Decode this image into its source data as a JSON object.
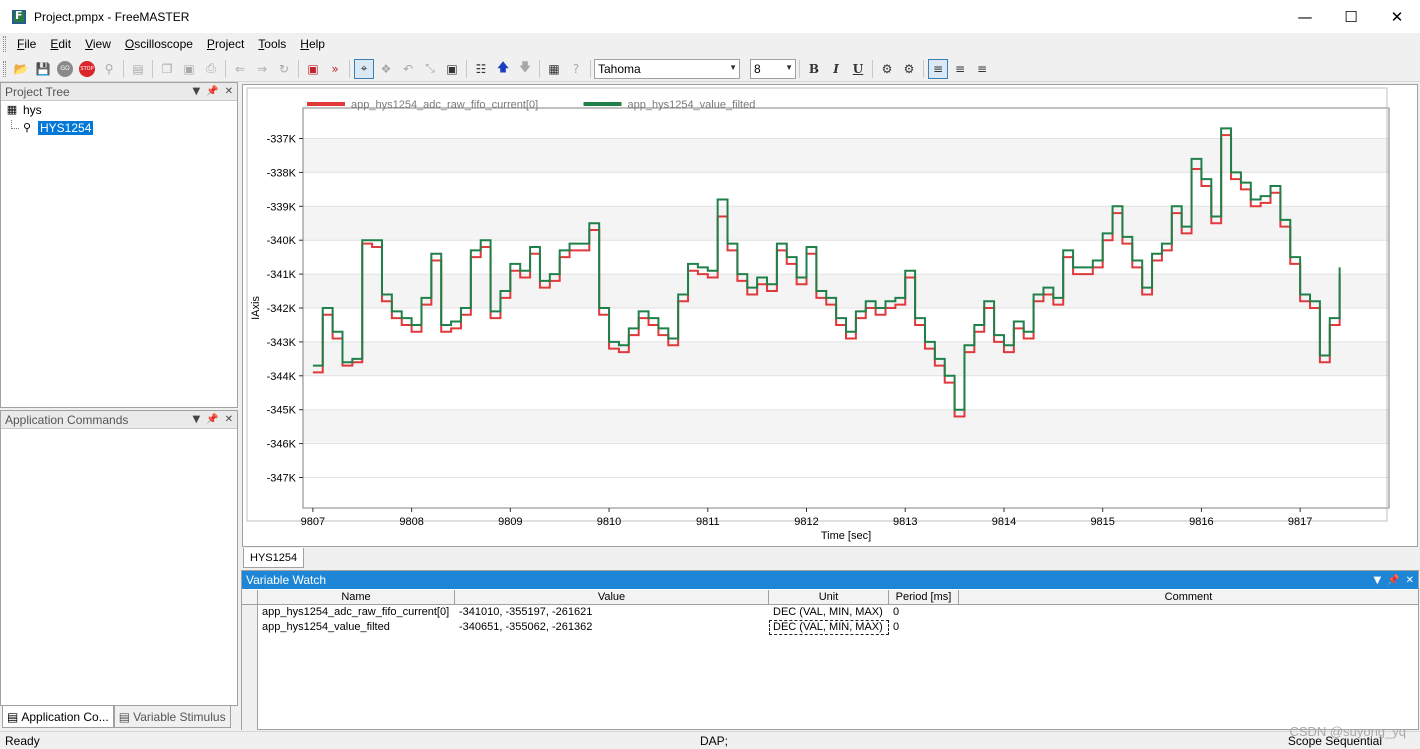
{
  "window": {
    "title": "Project.pmpx - FreeMASTER"
  },
  "menu": [
    "File",
    "Edit",
    "View",
    "Oscilloscope",
    "Project",
    "Tools",
    "Help"
  ],
  "toolbar": {
    "font_name": "Tahoma",
    "font_size": "8"
  },
  "project_tree": {
    "title": "Project Tree",
    "root": "hys",
    "child": "HYS1254"
  },
  "app_commands": {
    "title": "Application Commands"
  },
  "left_tabs": [
    "Application Co...",
    "Variable Stimulus"
  ],
  "scope_tab": "HYS1254",
  "chart_data": {
    "type": "line",
    "xlabel": "Time [sec]",
    "ylabel": "IAxis",
    "xlim": [
      9806.9,
      9817.9
    ],
    "ylim": [
      -347.9,
      -336.1
    ],
    "x_ticks": [
      "9807",
      "9808",
      "9809",
      "9810",
      "9811",
      "9812",
      "9813",
      "9814",
      "9815",
      "9816",
      "9817"
    ],
    "y_ticks": [
      "-337K",
      "-338K",
      "-339K",
      "-340K",
      "-341K",
      "-342K",
      "-343K",
      "-344K",
      "-345K",
      "-346K",
      "-347K"
    ],
    "y_tick_values": [
      -337,
      -338,
      -339,
      -340,
      -341,
      -342,
      -343,
      -344,
      -345,
      -346,
      -347
    ],
    "x_tick_values": [
      9807,
      9808,
      9809,
      9810,
      9811,
      9812,
      9813,
      9814,
      9815,
      9816,
      9817
    ],
    "legend_position": "top-left",
    "grid": true,
    "series": [
      {
        "name": "app_hys1254_adc_raw_fifo_current[0]",
        "color": "#e0393b",
        "x": [
          9807.0,
          9807.1,
          9807.2,
          9807.3,
          9807.4,
          9807.5,
          9807.6,
          9807.7,
          9807.8,
          9807.9,
          9808.0,
          9808.1,
          9808.2,
          9808.3,
          9808.4,
          9808.5,
          9808.6,
          9808.7,
          9808.8,
          9808.9,
          9809.0,
          9809.1,
          9809.2,
          9809.3,
          9809.4,
          9809.5,
          9809.6,
          9809.7,
          9809.8,
          9809.9,
          9810.0,
          9810.1,
          9810.2,
          9810.3,
          9810.4,
          9810.5,
          9810.6,
          9810.7,
          9810.8,
          9810.9,
          9811.0,
          9811.1,
          9811.2,
          9811.3,
          9811.4,
          9811.5,
          9811.6,
          9811.7,
          9811.8,
          9811.9,
          9812.0,
          9812.1,
          9812.2,
          9812.3,
          9812.4,
          9812.5,
          9812.6,
          9812.7,
          9812.8,
          9812.9,
          9813.0,
          9813.1,
          9813.2,
          9813.3,
          9813.4,
          9813.5,
          9813.6,
          9813.7,
          9813.8,
          9813.9,
          9814.0,
          9814.1,
          9814.2,
          9814.3,
          9814.4,
          9814.5,
          9814.6,
          9814.7,
          9814.8,
          9814.9,
          9815.0,
          9815.1,
          9815.2,
          9815.3,
          9815.4,
          9815.5,
          9815.6,
          9815.7,
          9815.8,
          9815.9,
          9816.0,
          9816.1,
          9816.2,
          9816.3,
          9816.4,
          9816.5,
          9816.6,
          9816.7,
          9816.8,
          9816.9,
          9817.0,
          9817.1,
          9817.2,
          9817.3,
          9817.4
        ],
        "y": [
          -343.9,
          -342.2,
          -342.9,
          -343.7,
          -343.6,
          -340.1,
          -340.2,
          -341.8,
          -342.3,
          -342.5,
          -342.7,
          -341.9,
          -340.6,
          -342.7,
          -342.6,
          -342.2,
          -340.5,
          -340.2,
          -342.3,
          -341.7,
          -340.9,
          -341.1,
          -340.4,
          -341.4,
          -341.2,
          -340.5,
          -340.3,
          -340.3,
          -339.7,
          -342.2,
          -343.2,
          -343.3,
          -342.8,
          -342.3,
          -342.5,
          -342.8,
          -343.1,
          -341.8,
          -340.9,
          -341.0,
          -341.1,
          -339.3,
          -340.3,
          -341.2,
          -341.6,
          -341.3,
          -341.5,
          -340.3,
          -340.7,
          -341.3,
          -340.4,
          -341.7,
          -341.9,
          -342.5,
          -342.9,
          -342.3,
          -342.0,
          -342.2,
          -342.0,
          -341.9,
          -341.1,
          -342.5,
          -343.2,
          -343.7,
          -344.2,
          -345.2,
          -343.3,
          -342.7,
          -342.0,
          -343.0,
          -343.3,
          -342.6,
          -342.9,
          -341.8,
          -341.6,
          -341.9,
          -340.5,
          -341.0,
          -341.0,
          -340.8,
          -340.0,
          -339.2,
          -340.1,
          -340.8,
          -341.6,
          -340.6,
          -340.3,
          -339.2,
          -339.8,
          -337.9,
          -338.4,
          -339.5,
          -336.9,
          -338.2,
          -338.5,
          -339.0,
          -338.9,
          -338.6,
          -339.6,
          -340.7,
          -341.8,
          -342.0,
          -343.6,
          -342.5,
          -341.0
        ]
      },
      {
        "name": "app_hys1254_value_filted",
        "color": "#1f8049",
        "x": [
          9807.0,
          9807.1,
          9807.2,
          9807.3,
          9807.4,
          9807.5,
          9807.6,
          9807.7,
          9807.8,
          9807.9,
          9808.0,
          9808.1,
          9808.2,
          9808.3,
          9808.4,
          9808.5,
          9808.6,
          9808.7,
          9808.8,
          9808.9,
          9809.0,
          9809.1,
          9809.2,
          9809.3,
          9809.4,
          9809.5,
          9809.6,
          9809.7,
          9809.8,
          9809.9,
          9810.0,
          9810.1,
          9810.2,
          9810.3,
          9810.4,
          9810.5,
          9810.6,
          9810.7,
          9810.8,
          9810.9,
          9811.0,
          9811.1,
          9811.2,
          9811.3,
          9811.4,
          9811.5,
          9811.6,
          9811.7,
          9811.8,
          9811.9,
          9812.0,
          9812.1,
          9812.2,
          9812.3,
          9812.4,
          9812.5,
          9812.6,
          9812.7,
          9812.8,
          9812.9,
          9813.0,
          9813.1,
          9813.2,
          9813.3,
          9813.4,
          9813.5,
          9813.6,
          9813.7,
          9813.8,
          9813.9,
          9814.0,
          9814.1,
          9814.2,
          9814.3,
          9814.4,
          9814.5,
          9814.6,
          9814.7,
          9814.8,
          9814.9,
          9815.0,
          9815.1,
          9815.2,
          9815.3,
          9815.4,
          9815.5,
          9815.6,
          9815.7,
          9815.8,
          9815.9,
          9816.0,
          9816.1,
          9816.2,
          9816.3,
          9816.4,
          9816.5,
          9816.6,
          9816.7,
          9816.8,
          9816.9,
          9817.0,
          9817.1,
          9817.2,
          9817.3,
          9817.4
        ],
        "y": [
          -343.7,
          -342.0,
          -342.7,
          -343.6,
          -343.5,
          -340.0,
          -340.0,
          -341.6,
          -342.1,
          -342.3,
          -342.5,
          -341.7,
          -340.4,
          -342.5,
          -342.4,
          -342.0,
          -340.3,
          -340.0,
          -342.1,
          -341.5,
          -340.7,
          -340.9,
          -340.2,
          -341.2,
          -341.0,
          -340.3,
          -340.1,
          -340.1,
          -339.5,
          -342.0,
          -343.0,
          -343.1,
          -342.6,
          -342.1,
          -342.3,
          -342.6,
          -342.9,
          -341.6,
          -340.7,
          -340.8,
          -340.9,
          -338.8,
          -340.1,
          -341.0,
          -341.4,
          -341.1,
          -341.3,
          -340.1,
          -340.5,
          -341.1,
          -340.2,
          -341.5,
          -341.7,
          -342.3,
          -342.7,
          -342.1,
          -341.8,
          -342.0,
          -341.8,
          -341.7,
          -340.9,
          -342.3,
          -343.0,
          -343.5,
          -344.0,
          -345.0,
          -343.1,
          -342.5,
          -341.8,
          -342.8,
          -343.1,
          -342.4,
          -342.7,
          -341.6,
          -341.4,
          -341.7,
          -340.3,
          -340.8,
          -340.8,
          -340.6,
          -339.8,
          -339.0,
          -339.9,
          -340.6,
          -341.4,
          -340.4,
          -340.1,
          -339.0,
          -339.6,
          -337.6,
          -338.2,
          -339.3,
          -336.7,
          -338.0,
          -338.3,
          -338.8,
          -338.7,
          -338.4,
          -339.4,
          -340.5,
          -341.6,
          -341.8,
          -343.4,
          -342.3,
          -340.8
        ]
      }
    ]
  },
  "variable_watch": {
    "title": "Variable Watch",
    "columns": [
      "Name",
      "Value",
      "Unit",
      "Period [ms]",
      "Comment"
    ],
    "rows": [
      {
        "name": "app_hys1254_adc_raw_fifo_current[0]",
        "value": "-341010, -355197, -261621",
        "unit": "DEC (VAL, MIN, MAX)",
        "period": "0",
        "comment": ""
      },
      {
        "name": "app_hys1254_value_filted",
        "value": "-340651, -355062, -261362",
        "unit": "DEC (VAL, MIN, MAX)",
        "period": "0",
        "comment": ""
      }
    ]
  },
  "statusbar": {
    "left": "Ready",
    "mid": "DAP;",
    "right": "Scope Sequential"
  },
  "watermark": "CSDN @suyong_yq"
}
